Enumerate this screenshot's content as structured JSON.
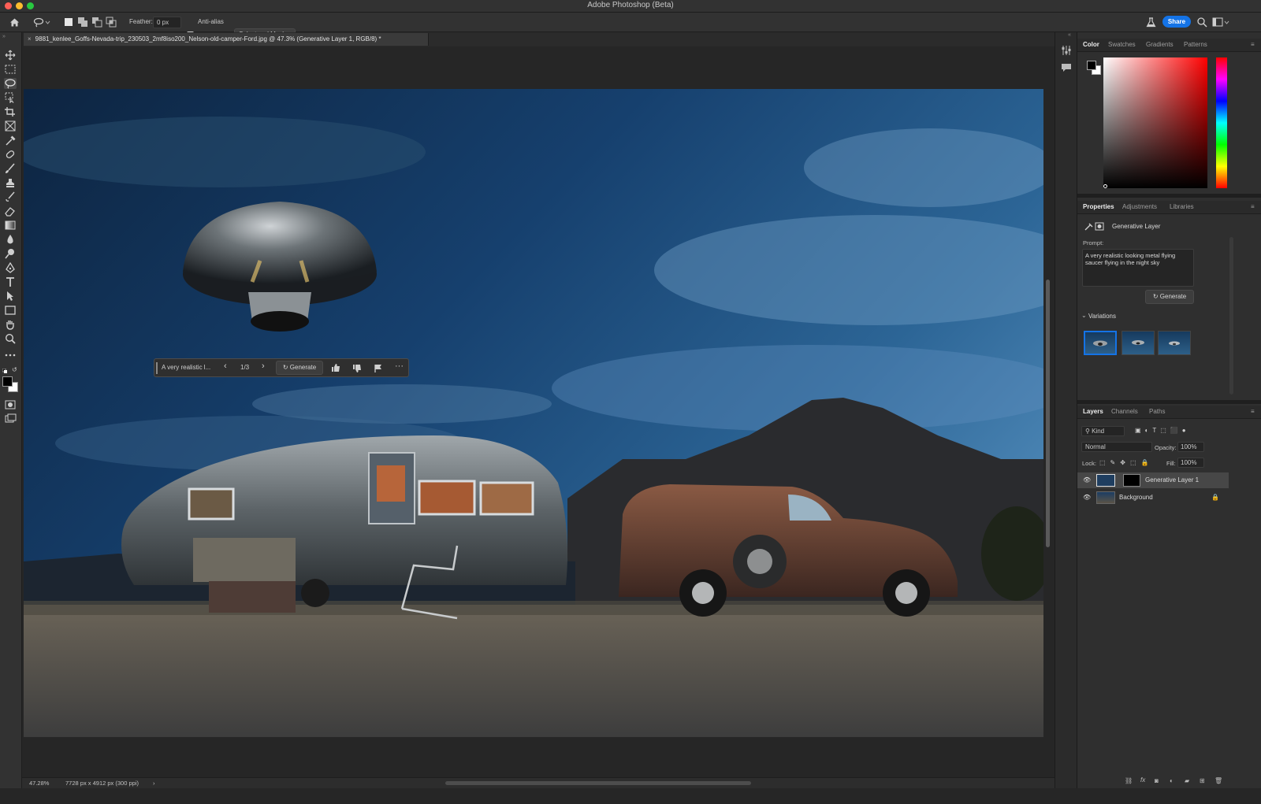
{
  "window": {
    "title": "Adobe Photoshop (Beta)"
  },
  "options_bar": {
    "feather_label": "Feather:",
    "feather_value": "0 px",
    "antialias_label": "Anti-alias",
    "antialias_checked": true,
    "select_mask_label": "Select and Mask...",
    "share_label": "Share"
  },
  "document": {
    "tab_title": "9881_kenlee_Goffs-Nevada-trip_230503_2mf8iso200_Nelson-old-camper-Ford.jpg @ 47.3% (Generative Layer 1, RGB/8) *"
  },
  "tools": [
    "move-icon",
    "marquee-icon",
    "lasso-icon",
    "object-select-icon",
    "crop-icon",
    "frame-icon",
    "eyedropper-icon",
    "healing-icon",
    "brush-icon",
    "stamp-icon",
    "history-brush-icon",
    "eraser-icon",
    "gradient-icon",
    "blur-icon",
    "dodge-icon",
    "pen-icon",
    "type-icon",
    "path-select-icon",
    "rectangle-icon",
    "hand-icon",
    "zoom-icon",
    "more-icon"
  ],
  "contextual_bar": {
    "prompt_short": "A very realistic l...",
    "counter": "1/3",
    "generate_label": "Generate"
  },
  "status_bar": {
    "zoom": "47.28%",
    "dimensions": "7728 px x 4912 px (300 ppi)"
  },
  "color_panel": {
    "tabs": [
      "Color",
      "Swatches",
      "Gradients",
      "Patterns"
    ],
    "active_tab": "Color",
    "foreground": "#000000",
    "background": "#ffffff"
  },
  "properties_panel": {
    "tabs": [
      "Properties",
      "Adjustments",
      "Libraries"
    ],
    "active_tab": "Properties",
    "layer_type": "Generative Layer",
    "prompt_label": "Prompt:",
    "prompt_text": "A very realistic looking metal flying saucer flying in the night sky",
    "generate_label": "Generate",
    "variations_label": "Variations"
  },
  "layers_panel": {
    "tabs": [
      "Layers",
      "Channels",
      "Paths"
    ],
    "active_tab": "Layers",
    "filter_kind": "Kind",
    "blend_mode": "Normal",
    "opacity_label": "Opacity:",
    "opacity_value": "100%",
    "lock_label": "Lock:",
    "fill_label": "Fill:",
    "fill_value": "100%",
    "layers": [
      {
        "name": "Generative Layer 1",
        "selected": true,
        "locked": false
      },
      {
        "name": "Background",
        "selected": false,
        "locked": true
      }
    ]
  },
  "colors": {
    "accent": "#1473e6",
    "ui_background": "#323232",
    "panel_background": "#2f2f2f",
    "selected_layer": "#474747"
  }
}
